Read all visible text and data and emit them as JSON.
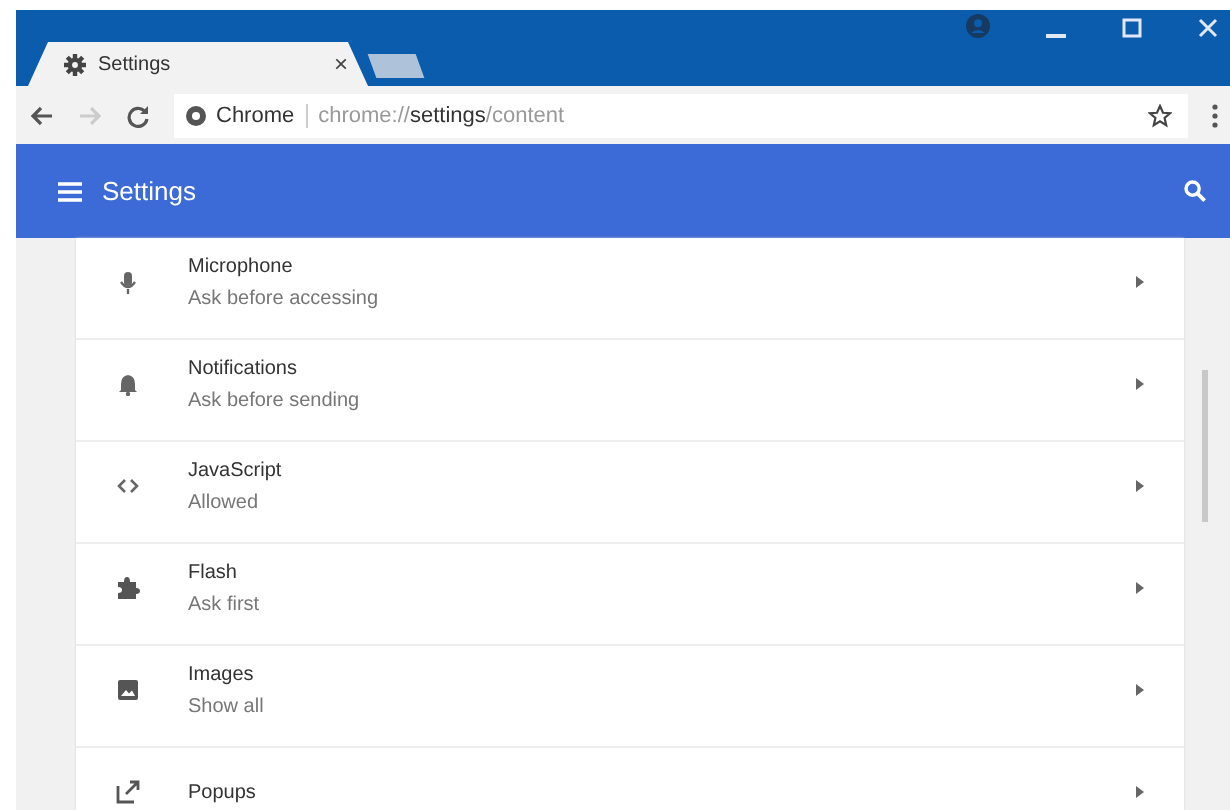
{
  "tabs": [
    {
      "label": "Settings",
      "selected": true,
      "close": "×"
    }
  ],
  "toolbar": {
    "site_label": "Chrome",
    "url": "chrome://**settings**/content"
  },
  "header": {
    "title": "Settings"
  },
  "items": [
    {
      "kind": "mic",
      "title": "Microphone",
      "subtitle": "Ask before accessing"
    },
    {
      "kind": "bell",
      "title": "Notifications",
      "subtitle": "Ask before sending"
    },
    {
      "kind": "code",
      "title": "JavaScript",
      "subtitle": "Allowed"
    },
    {
      "kind": "puzzle",
      "title": "Flash",
      "subtitle": "Ask first"
    },
    {
      "kind": "image",
      "title": "Images",
      "subtitle": "Show all"
    },
    {
      "kind": "popup",
      "title": "Popups"
    }
  ]
}
